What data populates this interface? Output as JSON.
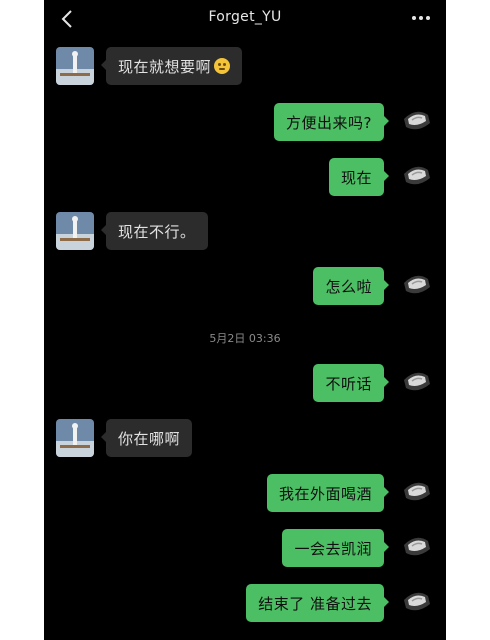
{
  "header": {
    "title": "Forget_YU",
    "back_icon": "chevron-left-icon",
    "more_icon": "more-dots-icon"
  },
  "colors": {
    "background": "#000000",
    "incoming_bubble": "#2c2c2c",
    "outgoing_bubble": "#4cbe63"
  },
  "timestamp": "5月2日 03:36",
  "messages": [
    {
      "direction": "in",
      "text": "现在就想要啊",
      "emoji": "thinking-face"
    },
    {
      "direction": "out",
      "text": "方便出来吗?"
    },
    {
      "direction": "out",
      "text": "现在"
    },
    {
      "direction": "in",
      "text": "现在不行。"
    },
    {
      "direction": "out",
      "text": "怎么啦"
    },
    {
      "direction": "out",
      "text": "不听话"
    },
    {
      "direction": "in",
      "text": "你在哪啊"
    },
    {
      "direction": "out",
      "text": "我在外面喝酒"
    },
    {
      "direction": "out",
      "text": "一会去凯润"
    },
    {
      "direction": "out",
      "text": "结束了 准备过去"
    }
  ]
}
